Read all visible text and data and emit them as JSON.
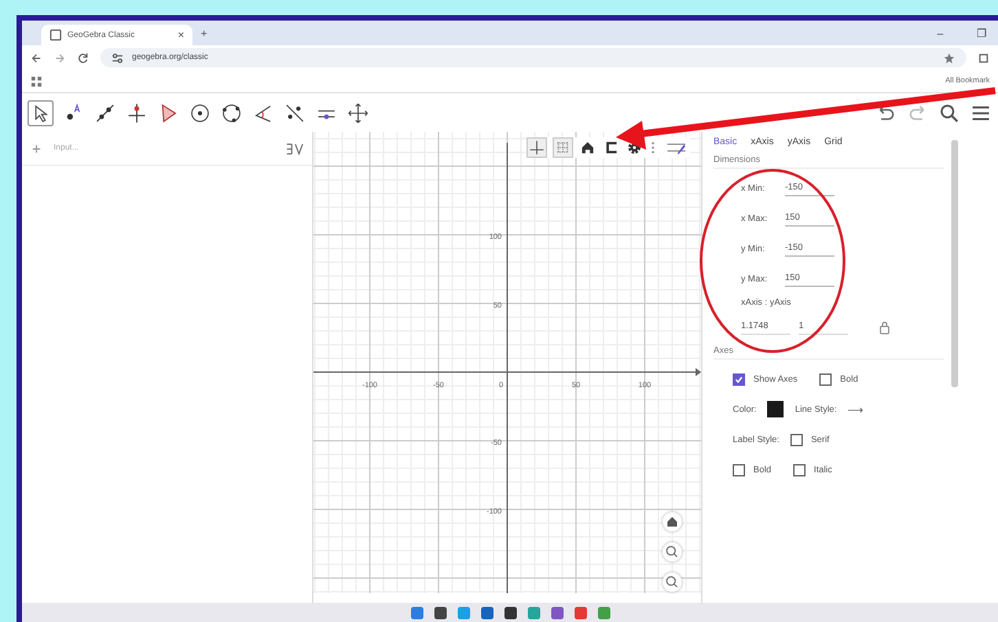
{
  "browser": {
    "tab_title": "GeoGebra Classic",
    "tab_close": "×",
    "new_tab": "+",
    "url": "geogebra.org/classic",
    "bookmarks": "All Bookmark",
    "window_controls": [
      "–",
      "❐"
    ]
  },
  "algebra": {
    "input_placeholder": "Input..."
  },
  "graphics": {
    "x_labels": [
      "-100",
      "-50",
      "0",
      "50",
      "100"
    ],
    "y_labels": [
      "100",
      "50",
      "-50",
      "-100"
    ]
  },
  "settings": {
    "tabs": [
      {
        "label": "Basic",
        "selected": true
      },
      {
        "label": "xAxis",
        "selected": false
      },
      {
        "label": "yAxis",
        "selected": false
      },
      {
        "label": "Grid",
        "selected": false
      }
    ],
    "dimensions_title": "Dimensions",
    "fields": [
      {
        "label": "x Min:",
        "value": "-150"
      },
      {
        "label": "x Max:",
        "value": "150"
      },
      {
        "label": "y Min:",
        "value": "-150"
      },
      {
        "label": "y Max:",
        "value": "150"
      }
    ],
    "ratio_label": "xAxis : yAxis",
    "ratio_values": [
      "1.1748",
      "1"
    ],
    "axes_title": "Axes",
    "axes_rows": [
      {
        "kind": "checks",
        "items": [
          {
            "label": "Show Axes",
            "checked": true
          },
          {
            "label": "Bold",
            "checked": false
          }
        ]
      },
      {
        "kind": "style",
        "color_label": "Color:",
        "color": "#1a1a1a",
        "line_label": "Line Style:",
        "line_glyph": "⟶"
      },
      {
        "kind": "label_style",
        "label": "Label Style:",
        "items": [
          {
            "label": "Serif",
            "checked": false
          }
        ]
      },
      {
        "kind": "checks",
        "items": [
          {
            "label": "Bold",
            "checked": false
          },
          {
            "label": "Italic",
            "checked": false
          }
        ]
      }
    ]
  }
}
